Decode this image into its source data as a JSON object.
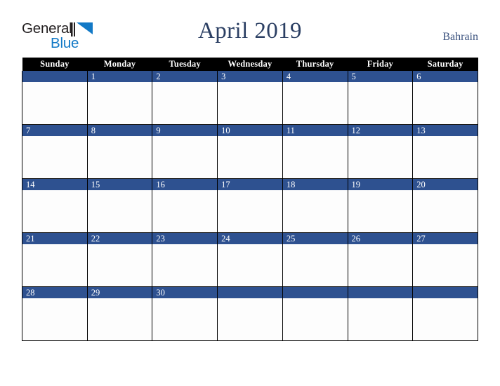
{
  "logo": {
    "text_top": "General",
    "text_bottom": "Blue",
    "mark": "triangle-icon"
  },
  "header": {
    "title": "April 2019",
    "country": "Bahrain"
  },
  "colors": {
    "accent_blue": "#2e5190",
    "logo_blue": "#1279c6",
    "title_navy": "#2b3f63",
    "header_bar": "#000000"
  },
  "calendar": {
    "month": "April",
    "year": "2019",
    "weekday_headers": [
      "Sunday",
      "Monday",
      "Tuesday",
      "Wednesday",
      "Thursday",
      "Friday",
      "Saturday"
    ],
    "weeks": [
      [
        "",
        "1",
        "2",
        "3",
        "4",
        "5",
        "6"
      ],
      [
        "7",
        "8",
        "9",
        "10",
        "11",
        "12",
        "13"
      ],
      [
        "14",
        "15",
        "16",
        "17",
        "18",
        "19",
        "20"
      ],
      [
        "21",
        "22",
        "23",
        "24",
        "25",
        "26",
        "27"
      ],
      [
        "28",
        "29",
        "30",
        "",
        "",
        "",
        ""
      ]
    ]
  }
}
